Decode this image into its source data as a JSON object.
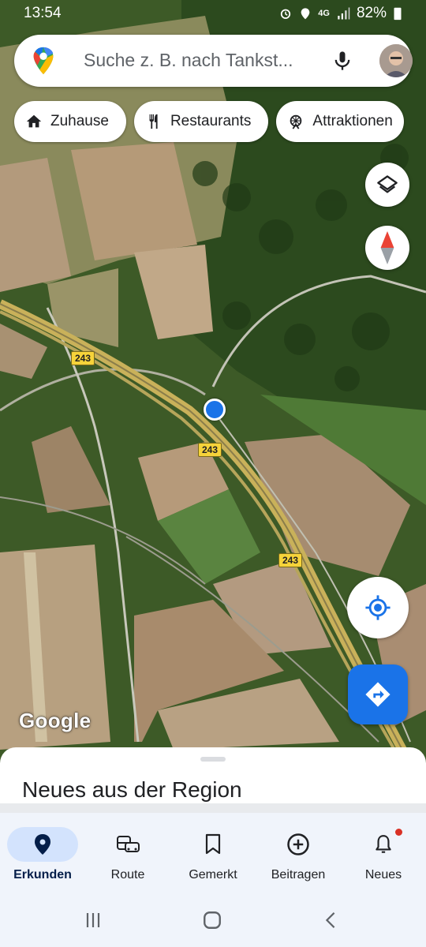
{
  "status": {
    "time": "13:54",
    "network": "4G",
    "battery": "82%"
  },
  "search": {
    "placeholder": "Suche z. B. nach Tankst..."
  },
  "chips": [
    {
      "label": "Zuhause",
      "icon": "home-icon"
    },
    {
      "label": "Restaurants",
      "icon": "restaurant-icon"
    },
    {
      "label": "Attraktionen",
      "icon": "attraction-icon"
    }
  ],
  "map": {
    "road_labels": [
      "243",
      "243",
      "243"
    ],
    "watermark": "Google"
  },
  "sheet": {
    "title": "Neues aus der Region"
  },
  "nav": [
    {
      "label": "Erkunden",
      "icon": "explore-pin-icon",
      "active": true
    },
    {
      "label": "Route",
      "icon": "commute-icon",
      "active": false
    },
    {
      "label": "Gemerkt",
      "icon": "bookmark-icon",
      "active": false
    },
    {
      "label": "Beitragen",
      "icon": "add-circle-icon",
      "active": false
    },
    {
      "label": "Neues",
      "icon": "bell-icon",
      "active": false,
      "badge": true
    }
  ],
  "colors": {
    "accent": "#1a73e8",
    "highway_label": "#f6d33a"
  }
}
